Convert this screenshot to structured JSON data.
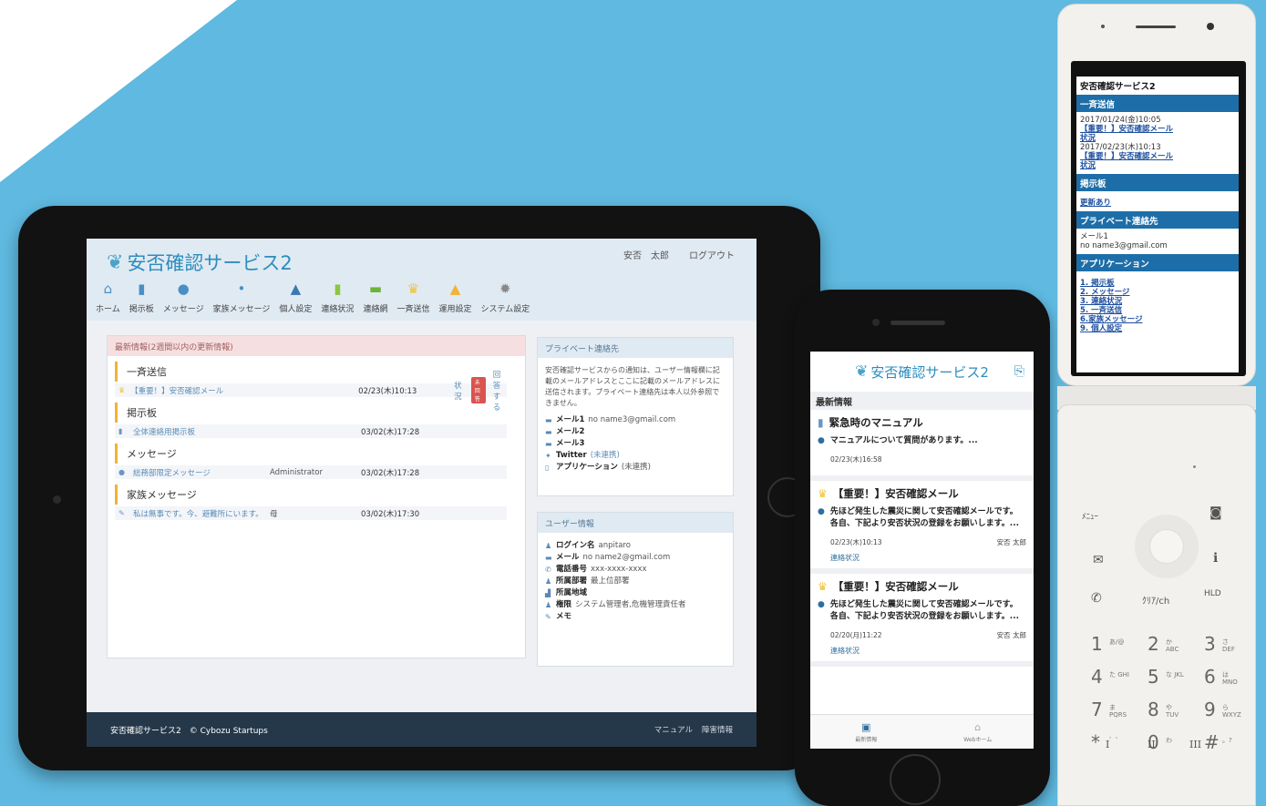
{
  "tablet": {
    "logo_text": "安否確認サービス2",
    "user_name": "安否　太郎",
    "logout": "ログアウト",
    "nav": [
      {
        "icon": "home-icon",
        "label": "ホーム",
        "color": "#4a8fc4",
        "glyph": "⌂"
      },
      {
        "icon": "bulletin-icon",
        "label": "掲示板",
        "color": "#4a8fc4",
        "glyph": "▮"
      },
      {
        "icon": "message-icon",
        "label": "メッセージ",
        "color": "#4a8fc4",
        "glyph": "●"
      },
      {
        "icon": "family-message-icon",
        "label": "家族メッセージ",
        "color": "#4a8fc4",
        "glyph": "•"
      },
      {
        "icon": "user-icon",
        "label": "個人設定",
        "color": "#3a78b0",
        "glyph": "▲"
      },
      {
        "icon": "status-icon",
        "label": "連絡状況",
        "color": "#8cc63f",
        "glyph": "▮"
      },
      {
        "icon": "network-icon",
        "label": "連絡網",
        "color": "#6bb33a",
        "glyph": "▬"
      },
      {
        "icon": "broadcast-icon",
        "label": "一斉送信",
        "color": "#f2c431",
        "glyph": "♛"
      },
      {
        "icon": "warning-icon",
        "label": "運用設定",
        "color": "#f2b233",
        "glyph": "▲"
      },
      {
        "icon": "gear-icon",
        "label": "システム設定",
        "color": "#888888",
        "glyph": "✹"
      }
    ],
    "news": {
      "header": "最新情報(2週間以内の更新情報)",
      "sections": [
        {
          "title": "一斉送信",
          "rows": [
            {
              "icon": "crown-icon",
              "title": "【重要！】安否確認メール",
              "who": "",
              "date": "02/23(木)10:13",
              "status": "状況",
              "badge": "未回答",
              "reply": "回答する"
            }
          ]
        },
        {
          "title": "掲示板",
          "rows": [
            {
              "icon": "bulletin-icon",
              "title": "全体連絡用掲示板",
              "who": "",
              "date": "03/02(木)17:28"
            }
          ]
        },
        {
          "title": "メッセージ",
          "rows": [
            {
              "icon": "message-icon",
              "title": "総務部限定メッセージ",
              "who": "Administrator",
              "date": "03/02(木)17:28"
            }
          ]
        },
        {
          "title": "家族メッセージ",
          "rows": [
            {
              "icon": "family-message-icon",
              "title": "私は無事です。今、避難所にいます。",
              "who": "母",
              "date": "03/02(木)17:30"
            }
          ]
        }
      ]
    },
    "private": {
      "header": "プライベート連絡先",
      "desc": "安否確認サービスからの通知は、ユーザー情報欄に記載のメールアドレスとここに記載のメールアドレスに送信されます。プライベート連絡先は本人以外参照できません。",
      "items": [
        {
          "icon": "mail-icon",
          "key": "メール1",
          "value": "no name3@gmail.com",
          "link": false
        },
        {
          "icon": "mail-icon",
          "key": "メール2",
          "value": "",
          "link": false
        },
        {
          "icon": "mail-icon",
          "key": "メール3",
          "value": "",
          "link": false
        },
        {
          "icon": "twitter-icon",
          "key": "Twitter",
          "value": "(未連携)",
          "link": true
        },
        {
          "icon": "phone-icon",
          "key": "アプリケーション",
          "value": "(未連携)",
          "link": false
        }
      ]
    },
    "user": {
      "header": "ユーザー情報",
      "items": [
        {
          "icon": "person-icon",
          "key": "ログイン名",
          "value": "anpitaro"
        },
        {
          "icon": "mail-icon",
          "key": "メール",
          "value": "no name2@gmail.com"
        },
        {
          "icon": "phone-icon",
          "key": "電話番号",
          "value": "xxx-xxxx-xxxx"
        },
        {
          "icon": "group-icon",
          "key": "所属部署",
          "value": "最上位部署"
        },
        {
          "icon": "region-icon",
          "key": "所属地域",
          "value": ""
        },
        {
          "icon": "role-icon",
          "key": "権限",
          "value": "システム管理者,危機管理責任者"
        },
        {
          "icon": "memo-icon",
          "key": "メモ",
          "value": ""
        }
      ]
    },
    "footer": {
      "left": "安否確認サービス2　© Cybozu Startups",
      "manual": "マニュアル",
      "failure": "障害情報"
    }
  },
  "phone": {
    "logo_text": "安否確認サービス2",
    "news_header": "最新情報",
    "cards": [
      {
        "icon": "bulletin-icon",
        "title": "緊急時のマニュアル",
        "body": "マニュアルについて質問があります。...",
        "date": "02/23(木)16:58",
        "author": "",
        "link": ""
      },
      {
        "icon": "crown-icon",
        "title": "【重要！】安否確認メール",
        "body": "先ほど発生した震災に関して安否確認メールです。\n各自、下記より安否状況の登録をお願いします。...",
        "date": "02/23(木)10:13",
        "author": "安否 太郎",
        "link": "連絡状況"
      },
      {
        "icon": "crown-icon",
        "title": "【重要！】安否確認メール",
        "body": "先ほど発生した震災に関して安否確認メールです。\n各自、下記より安否状況の登録をお願いします。...",
        "date": "02/20(月)11:22",
        "author": "安否 太郎",
        "link": "連絡状況"
      }
    ],
    "tabs": [
      {
        "label": "最新情報",
        "icon": "news-icon"
      },
      {
        "label": "Webホーム",
        "icon": "home-icon"
      }
    ]
  },
  "flip": {
    "title": "安否確認サービス2",
    "bar_broadcast": "一斉送信",
    "broadcast": [
      {
        "date": "2017/01/24(金)10:05",
        "link": "【重要！】安否確認メール",
        "status": "状況"
      },
      {
        "date": "2017/02/23(木)10:13",
        "link": "【重要！】安否確認メール",
        "status": "状況"
      }
    ],
    "bar_bulletin": "掲示板",
    "bulletin_link": "更新あり",
    "bar_private": "プライベート連絡先",
    "private_label": "メール1",
    "private_value": " no name3@gmail.com",
    "bar_apps": "アプリケーション",
    "apps": [
      "1. 掲示板",
      "2. メッセージ",
      "3. 連絡状況",
      "5. 一斉送信",
      "6.家族メッセージ",
      "9. 個人設定"
    ],
    "keys": {
      "menu": "ﾒﾆｭｰ",
      "clear": "ｸﾘｱ/ch",
      "hold": "HLD",
      "digits": [
        {
          "n": "1",
          "s": "あ/@"
        },
        {
          "n": "2",
          "s": "か ABC"
        },
        {
          "n": "3",
          "s": "さ DEF"
        },
        {
          "n": "4",
          "s": "た GHI"
        },
        {
          "n": "5",
          "s": "な JKL"
        },
        {
          "n": "6",
          "s": "は MNO"
        },
        {
          "n": "7",
          "s": "ま PQRS"
        },
        {
          "n": "8",
          "s": "や TUV"
        },
        {
          "n": "9",
          "s": "ら WXYZ"
        },
        {
          "n": "*",
          "s": "゛゜"
        },
        {
          "n": "0",
          "s": "わ"
        },
        {
          "n": "#",
          "s": "。?"
        }
      ],
      "bottom": [
        "I",
        "II",
        "III"
      ]
    }
  }
}
